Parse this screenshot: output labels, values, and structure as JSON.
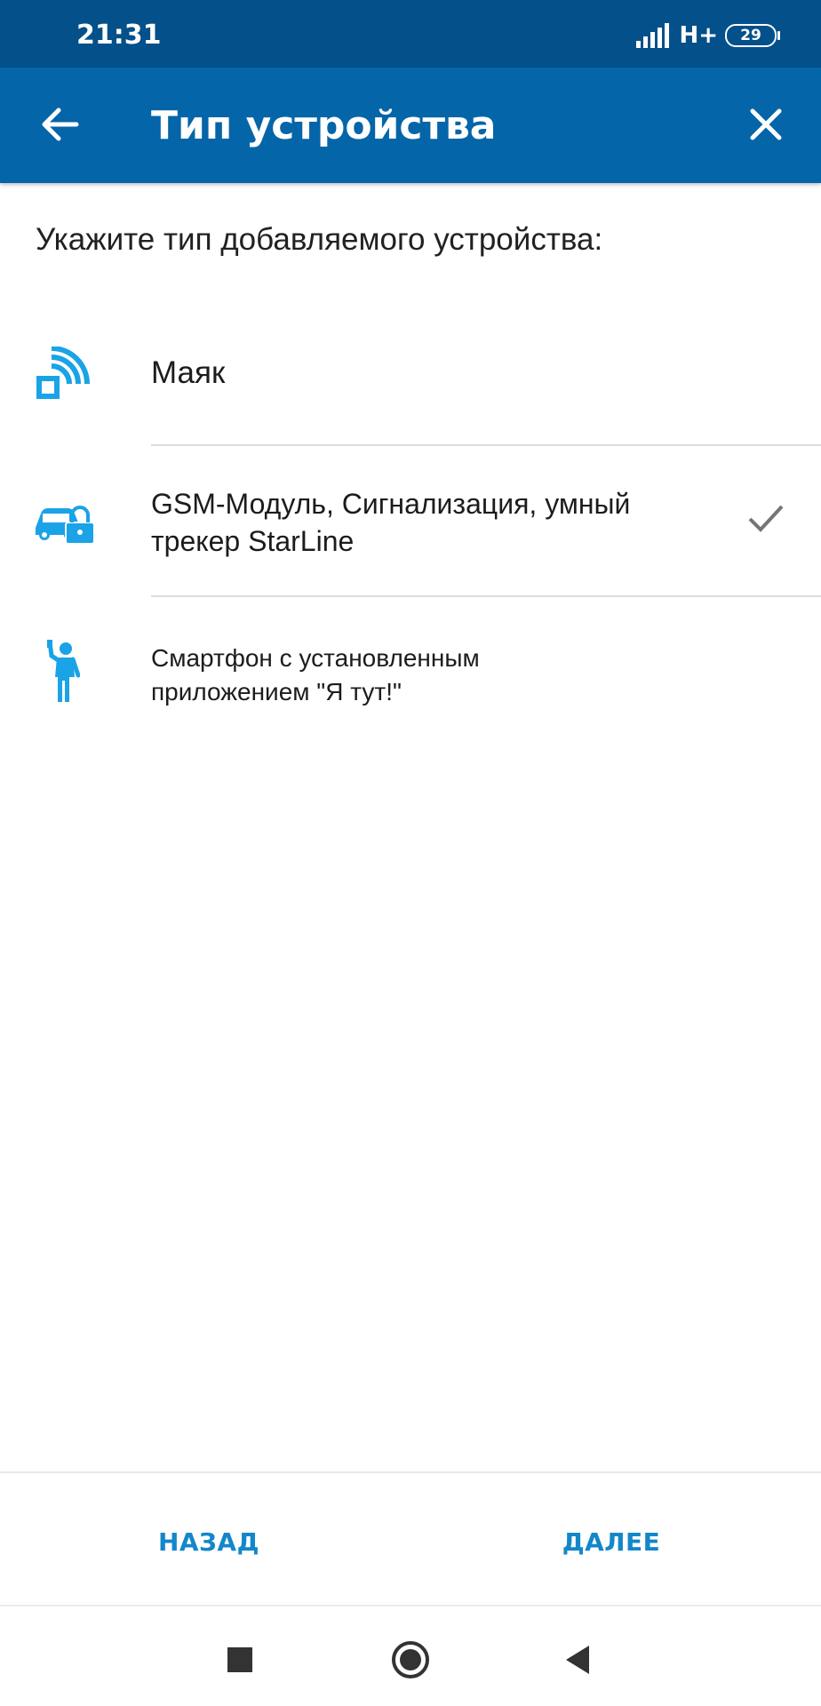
{
  "status_bar": {
    "time": "21:31",
    "network": "H+",
    "battery": "29"
  },
  "app_bar": {
    "title": "Тип устройства",
    "back_icon": "arrow-left-icon",
    "close_icon": "close-icon",
    "background": "#0465a9"
  },
  "content": {
    "prompt": "Укажите тип добавляемого устройства:",
    "options": [
      {
        "icon": "beacon-icon",
        "label": "Маяк",
        "selected": false
      },
      {
        "icon": "car-lock-icon",
        "label_line1": "GSM-Модуль, Сигнализация, умный",
        "label_line2": "трекер StarLine",
        "selected": true
      },
      {
        "icon": "person-phone-icon",
        "label_line1": "Смартфон с установленным",
        "label_line2": "приложением \"Я тут!\"",
        "selected": false
      }
    ],
    "accent": "#1aa3e6"
  },
  "footer": {
    "back_label": "НАЗАД",
    "next_label": "ДАЛЕЕ",
    "accent": "#1387c9"
  },
  "nav_bar": {
    "recents_icon": "square-icon",
    "home_icon": "circle-icon",
    "back_icon": "triangle-back-icon"
  }
}
